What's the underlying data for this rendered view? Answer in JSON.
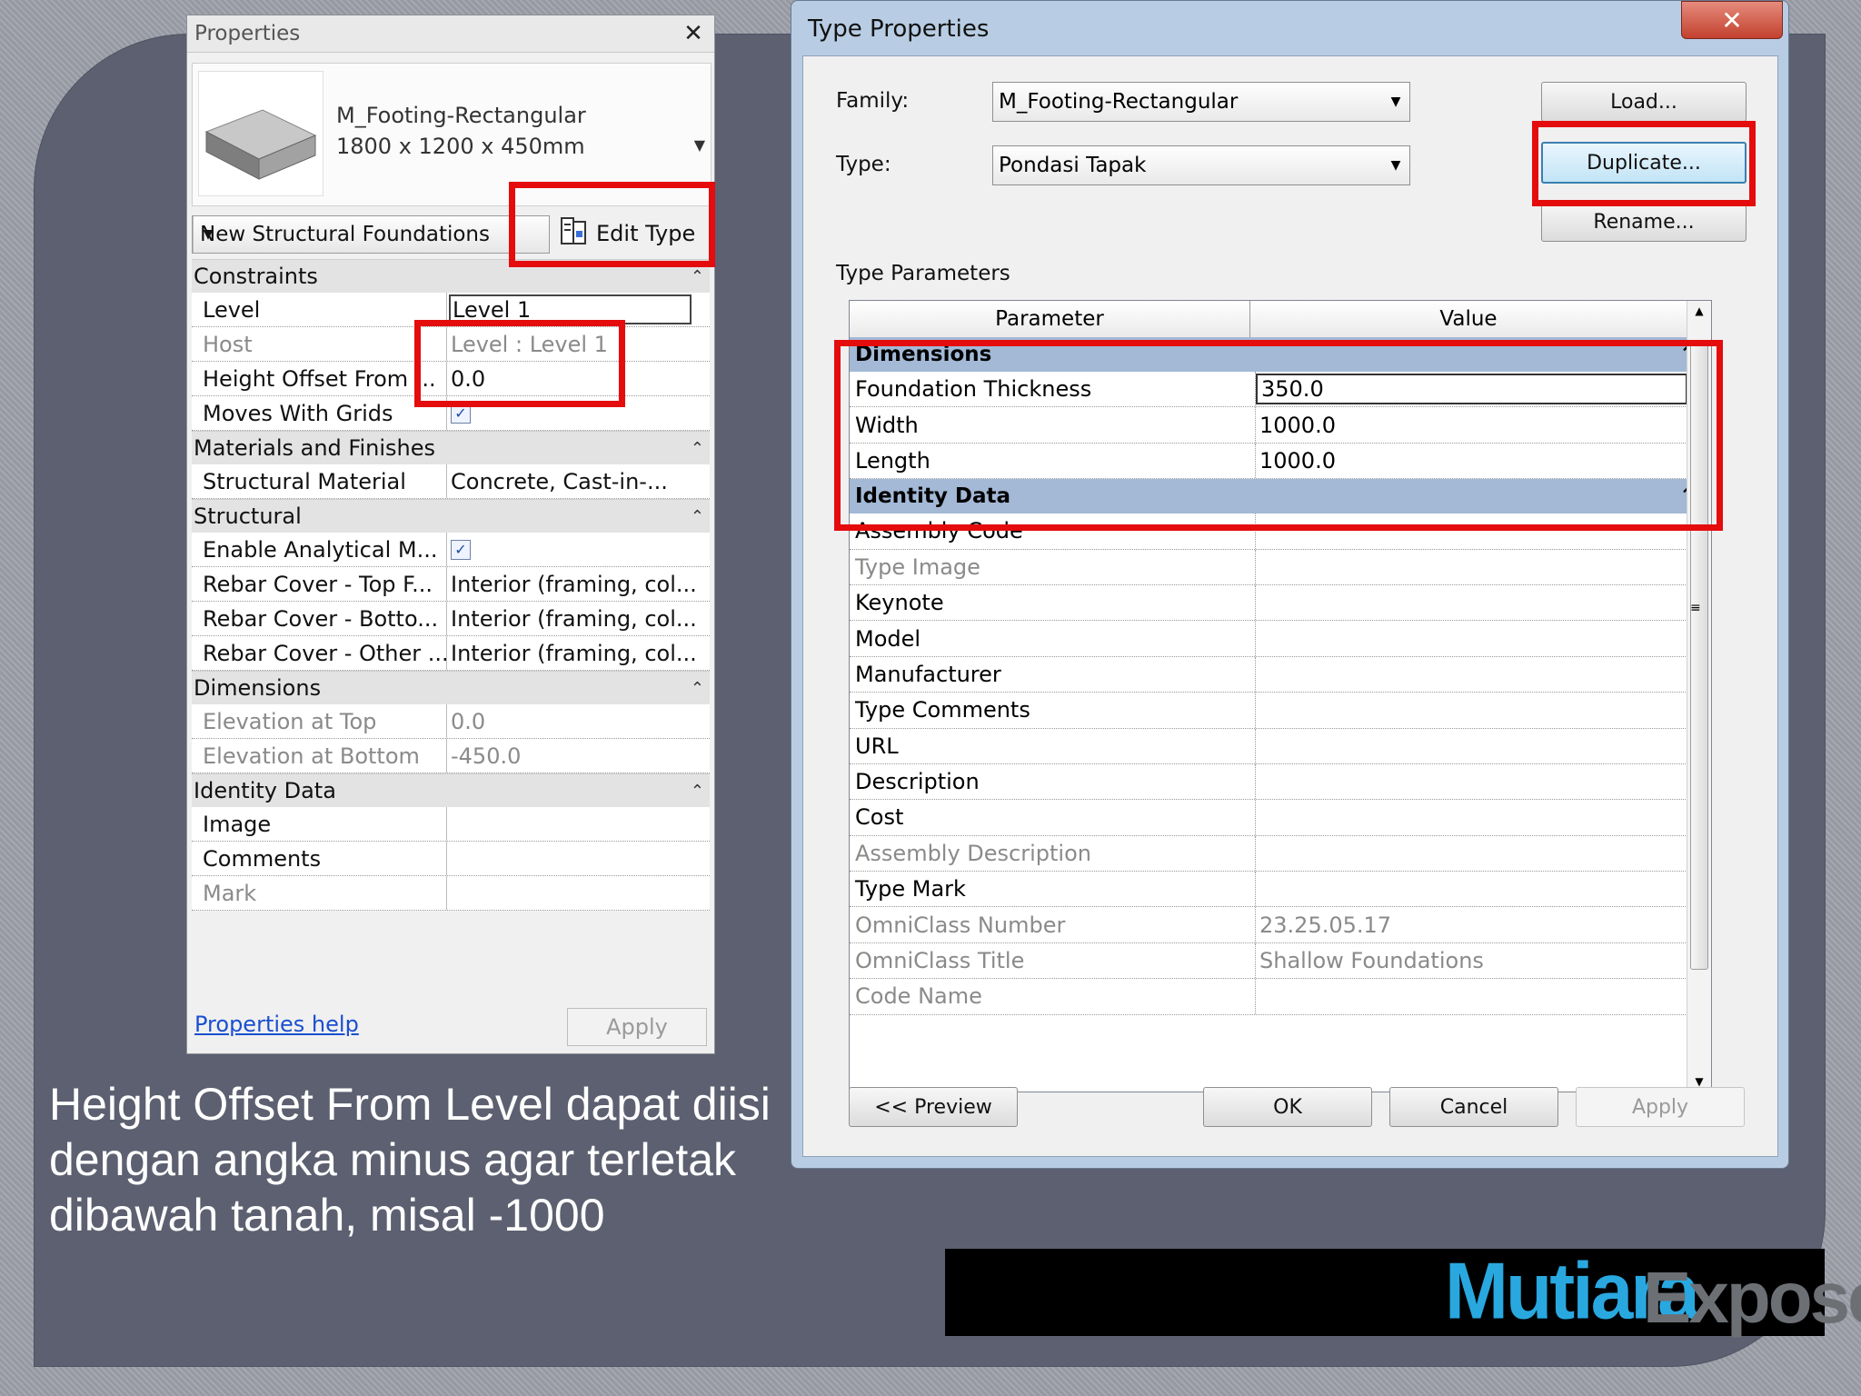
{
  "properties": {
    "title": "Properties",
    "close_glyph": "✕",
    "type_name": "M_Footing-Rectangular",
    "type_size": "1800 x 1200 x 450mm",
    "instance_selector": "New Structural Foundations",
    "edit_type_label": "Edit Type",
    "categories": [
      {
        "name": "Constraints",
        "rows": [
          {
            "k": "Level",
            "v": "Level 1",
            "state": "edit"
          },
          {
            "k": "Host",
            "v": "Level : Level 1",
            "state": "disabled"
          },
          {
            "k": "Height Offset From ...",
            "v": "0.0",
            "state": "normal"
          },
          {
            "k": "Moves With Grids",
            "v": "",
            "state": "checkbox"
          }
        ]
      },
      {
        "name": "Materials and Finishes",
        "rows": [
          {
            "k": "Structural Material",
            "v": "Concrete, Cast-in-...",
            "state": "normal"
          }
        ]
      },
      {
        "name": "Structural",
        "rows": [
          {
            "k": "Enable Analytical M...",
            "v": "",
            "state": "checkbox"
          },
          {
            "k": "Rebar Cover - Top F...",
            "v": "Interior (framing, col...",
            "state": "normal"
          },
          {
            "k": "Rebar Cover - Botto...",
            "v": "Interior (framing, col...",
            "state": "normal"
          },
          {
            "k": "Rebar Cover - Other ...",
            "v": "Interior (framing, col...",
            "state": "normal"
          }
        ]
      },
      {
        "name": "Dimensions",
        "rows": [
          {
            "k": "Elevation at Top",
            "v": "0.0",
            "state": "disabled"
          },
          {
            "k": "Elevation at Bottom",
            "v": "-450.0",
            "state": "disabled"
          }
        ]
      },
      {
        "name": "Identity Data",
        "rows": [
          {
            "k": "Image",
            "v": "",
            "state": "normal"
          },
          {
            "k": "Comments",
            "v": "",
            "state": "normal"
          },
          {
            "k": "Mark",
            "v": "",
            "state": "disabled"
          }
        ]
      }
    ],
    "help_link": "Properties help",
    "apply_label": "Apply"
  },
  "type_properties": {
    "title": "Type Properties",
    "family_label": "Family:",
    "family_value": "M_Footing-Rectangular",
    "type_label": "Type:",
    "type_value": "Pondasi Tapak",
    "load_label": "Load...",
    "duplicate_label": "Duplicate...",
    "rename_label": "Rename...",
    "section_label": "Type Parameters",
    "col_parameter": "Parameter",
    "col_value": "Value",
    "col_eq": "=",
    "categories": [
      {
        "name": "Dimensions",
        "rows": [
          {
            "p": "Foundation Thickness",
            "v": "350.0",
            "state": "edit",
            "fx": true
          },
          {
            "p": "Width",
            "v": "1000.0",
            "state": "normal",
            "fx": true
          },
          {
            "p": "Length",
            "v": "1000.0",
            "state": "normal",
            "fx": true
          }
        ]
      },
      {
        "name": "Identity Data",
        "rows": [
          {
            "p": "Assembly Code",
            "v": "",
            "state": "normal",
            "fx": true
          },
          {
            "p": "Type Image",
            "v": "",
            "state": "disabled",
            "fx": false
          },
          {
            "p": "Keynote",
            "v": "",
            "state": "normal",
            "fx": true
          },
          {
            "p": "Model",
            "v": "",
            "state": "normal",
            "fx": true
          },
          {
            "p": "Manufacturer",
            "v": "",
            "state": "normal",
            "fx": true
          },
          {
            "p": "Type Comments",
            "v": "",
            "state": "normal",
            "fx": true
          },
          {
            "p": "URL",
            "v": "",
            "state": "normal",
            "fx": true
          },
          {
            "p": "Description",
            "v": "",
            "state": "normal",
            "fx": true
          },
          {
            "p": "Cost",
            "v": "",
            "state": "normal",
            "fx": true
          },
          {
            "p": "Assembly Description",
            "v": "",
            "state": "disabled",
            "fx": false
          },
          {
            "p": "Type Mark",
            "v": "",
            "state": "normal",
            "fx": false
          },
          {
            "p": "OmniClass Number",
            "v": "23.25.05.17",
            "state": "disabled",
            "fx": false
          },
          {
            "p": "OmniClass Title",
            "v": "Shallow Foundations",
            "state": "disabled",
            "fx": false
          },
          {
            "p": "Code Name",
            "v": "",
            "state": "disabled",
            "fx": false
          }
        ]
      }
    ],
    "preview_label": "<< Preview",
    "ok_label": "OK",
    "cancel_label": "Cancel",
    "apply_label": "Apply"
  },
  "caption": "Height Offset From Level dapat diisi dengan angka minus agar terletak dibawah tanah, misal -1000",
  "logo": {
    "part1": "Mutiara",
    "part2": "Expose"
  },
  "colors": {
    "highlight": "#e40c0c",
    "category_band": "#a3b9d6",
    "logo_blue": "#29a8e0"
  }
}
